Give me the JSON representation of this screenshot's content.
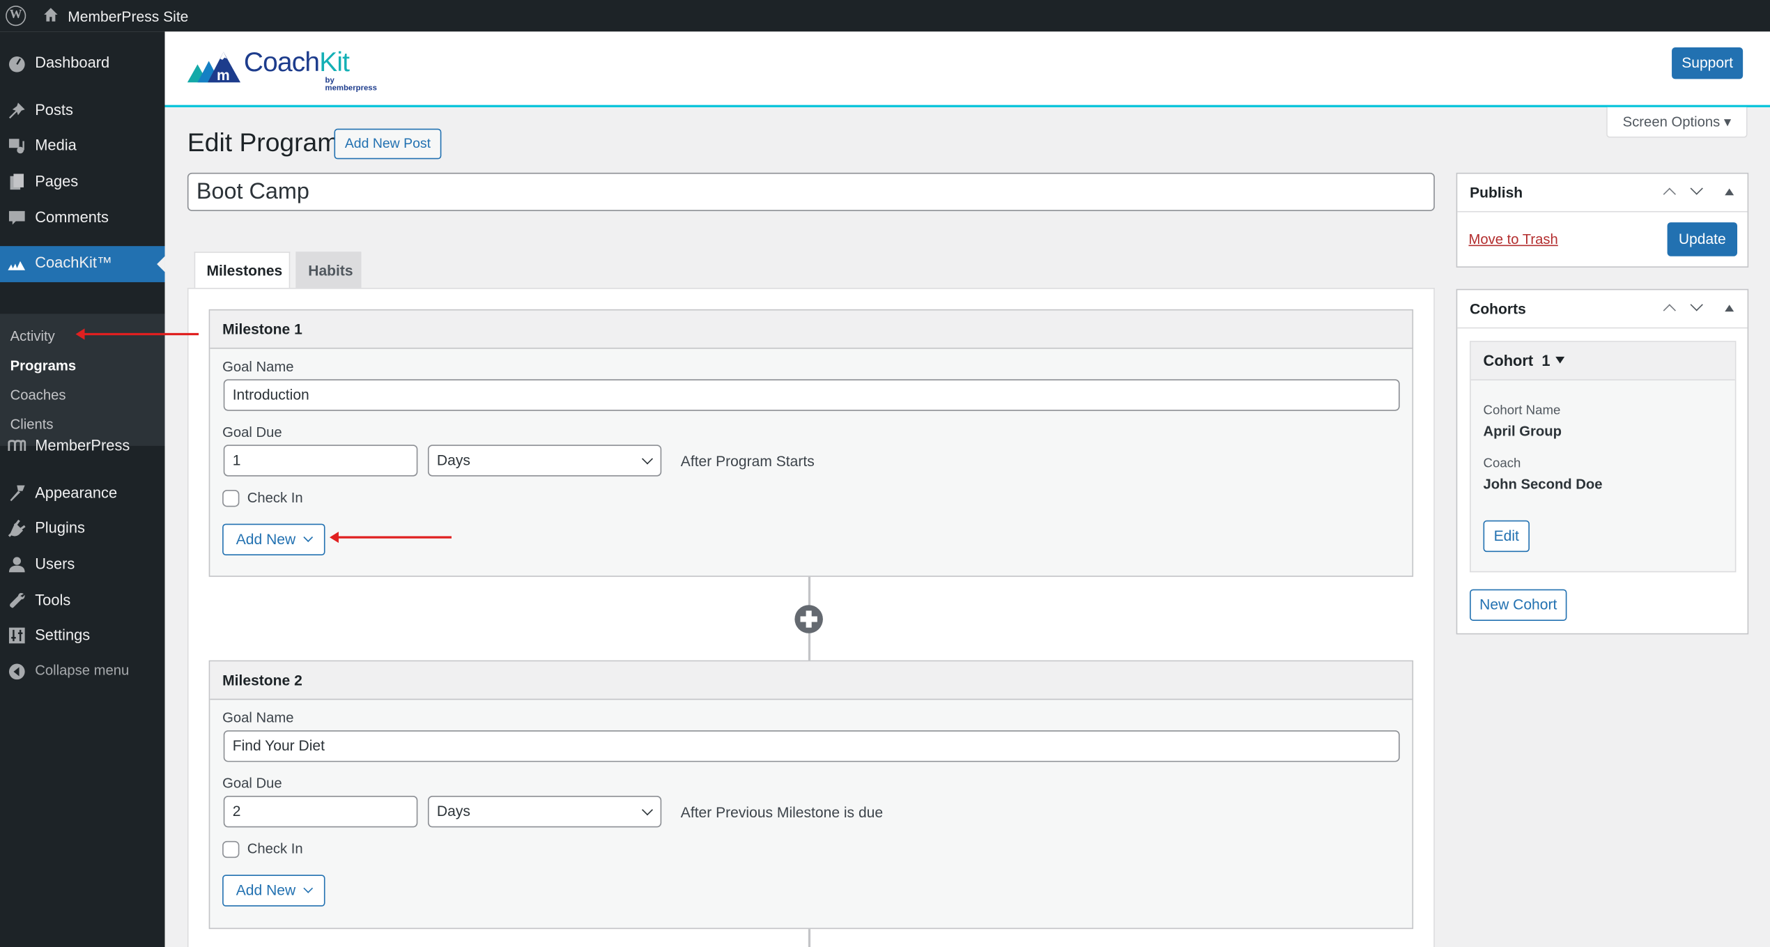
{
  "adminbar": {
    "site_name": "MemberPress Site"
  },
  "sidebar": {
    "items": [
      {
        "label": "Dashboard",
        "icon": "dashboard-icon"
      },
      {
        "label": "Posts",
        "icon": "pin-icon"
      },
      {
        "label": "Media",
        "icon": "media-icon"
      },
      {
        "label": "Pages",
        "icon": "pages-icon"
      },
      {
        "label": "Comments",
        "icon": "comments-icon"
      },
      {
        "label": "CoachKit™",
        "icon": "mountains-icon"
      },
      {
        "label": "MemberPress",
        "icon": "memberpress-icon"
      },
      {
        "label": "Appearance",
        "icon": "brush-icon"
      },
      {
        "label": "Plugins",
        "icon": "plugin-icon"
      },
      {
        "label": "Users",
        "icon": "user-icon"
      },
      {
        "label": "Tools",
        "icon": "wrench-icon"
      },
      {
        "label": "Settings",
        "icon": "settings-icon"
      },
      {
        "label": "Collapse menu",
        "icon": "collapse-icon"
      }
    ],
    "submenu": [
      "Activity",
      "Programs",
      "Coaches",
      "Clients"
    ],
    "current_submenu": "Programs"
  },
  "header": {
    "logo_word_a": "Coach",
    "logo_word_b": "Kit",
    "logo_by": "by memberpress",
    "support_label": "Support",
    "screen_options_label": "Screen Options ▾"
  },
  "page": {
    "title": "Edit Program",
    "add_new_label": "Add New Post",
    "post_title": "Boot Camp",
    "tabs": [
      "Milestones",
      "Habits"
    ],
    "active_tab": "Milestones"
  },
  "milestones": [
    {
      "title": "Milestone 1",
      "goal_name_label": "Goal Name",
      "goal_name": "Introduction",
      "goal_due_label": "Goal Due",
      "due_value": "1",
      "due_unit": "Days",
      "due_relative": "After Program Starts",
      "check_in_label": "Check In",
      "check_in": false,
      "add_new_label": "Add New"
    },
    {
      "title": "Milestone 2",
      "goal_name_label": "Goal Name",
      "goal_name": "Find Your Diet",
      "goal_due_label": "Goal Due",
      "due_value": "2",
      "due_unit": "Days",
      "due_relative": "After Previous Milestone is due",
      "check_in_label": "Check In",
      "check_in": false,
      "add_new_label": "Add New"
    }
  ],
  "publish": {
    "title": "Publish",
    "trash_label": "Move to Trash",
    "update_label": "Update"
  },
  "cohorts": {
    "title": "Cohorts",
    "cohort_title": "Cohort  1",
    "name_label": "Cohort Name",
    "name_value": "April Group",
    "coach_label": "Coach",
    "coach_value": "John Second Doe",
    "edit_label": "Edit",
    "new_label": "New Cohort"
  },
  "colors": {
    "accent": "#2271b1",
    "admin_dark": "#1d2327",
    "header_rule": "#06c3da",
    "danger": "#b32d2e",
    "annotation_arrow": "#e02020"
  }
}
